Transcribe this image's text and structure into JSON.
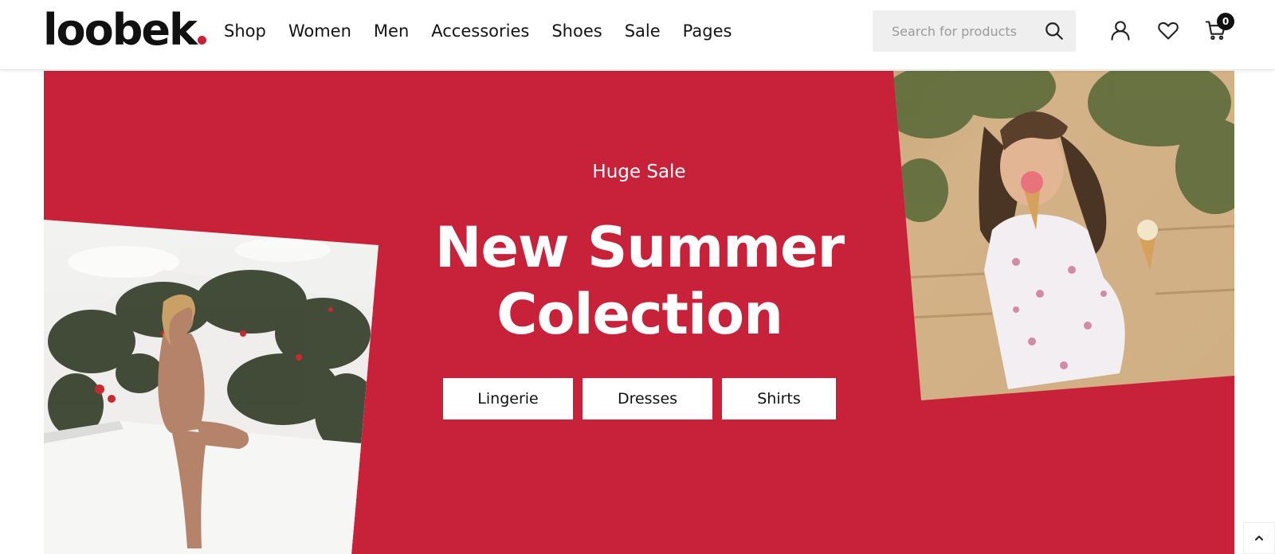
{
  "header": {
    "logo_text": "loobek",
    "nav": [
      "Shop",
      "Women",
      "Men",
      "Accessories",
      "Shoes",
      "Sale",
      "Pages"
    ],
    "search_placeholder": "Search for products",
    "cart_count": "0",
    "icons": [
      "search-icon",
      "user-icon",
      "heart-icon",
      "cart-icon"
    ]
  },
  "hero": {
    "subtitle": "Huge Sale",
    "title": "New Summer Colection",
    "buttons": [
      "Lingerie",
      "Dresses",
      "Shirts"
    ],
    "background_color": "#c8223a"
  },
  "colors": {
    "accent": "#c8223a",
    "text": "#111111"
  }
}
